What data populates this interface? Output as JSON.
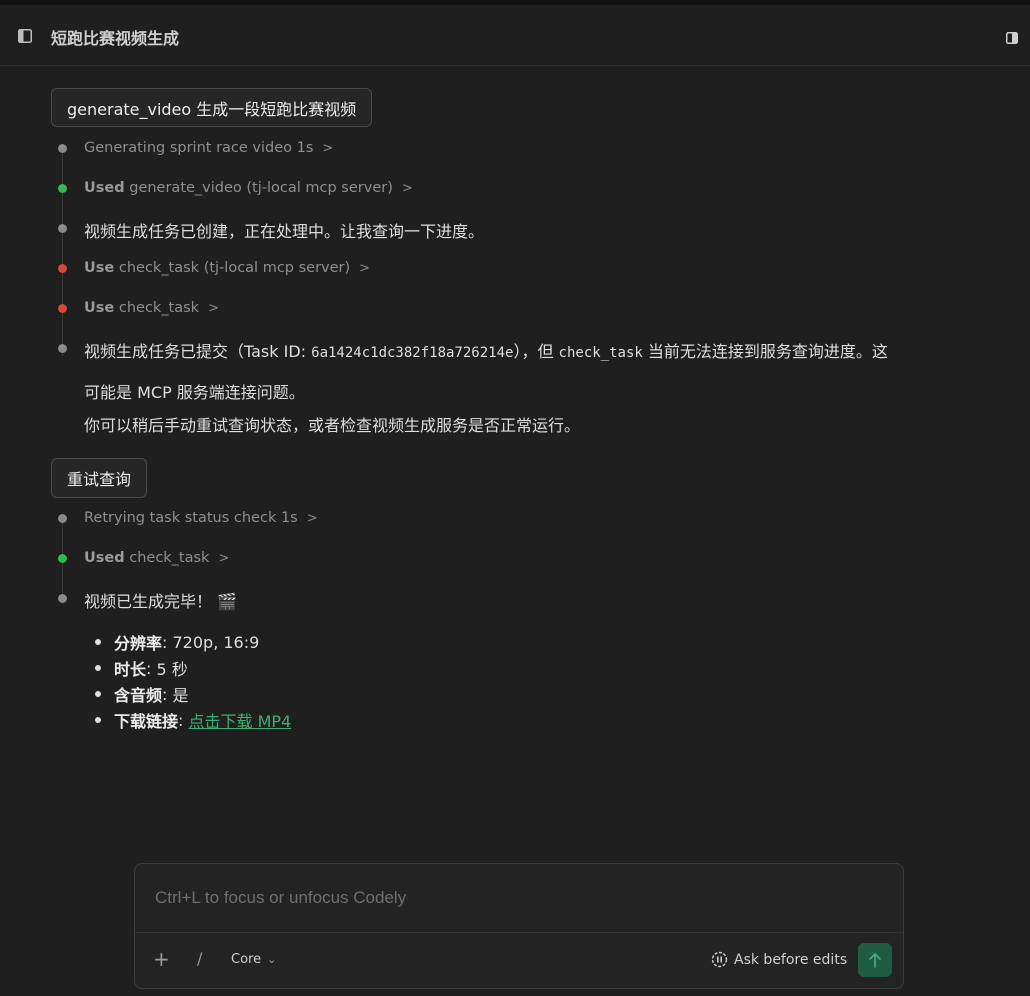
{
  "header": {
    "title": "短跑比赛视频生成"
  },
  "thread": {
    "prompt1": "generate_video 生成一段短跑比赛视频",
    "steps1": [
      {
        "label": "",
        "text": "Generating sprint race video 1s"
      },
      {
        "label": "Used",
        "text": "generate_video (tj-local mcp server)"
      }
    ],
    "msg1": "视频生成任务已创建，正在处理中。让我查询一下进度。",
    "steps2": [
      {
        "label": "Use",
        "text": "check_task (tj-local mcp server)"
      },
      {
        "label": "Use",
        "text": "check_task"
      }
    ],
    "msg2": {
      "part1": "视频生成任务已提交（Task ID: ",
      "task_id": "6a1424c1dc382f18a726214e",
      "part2": "），但 ",
      "code": "check_task",
      "part3": " 当前无法连接到服务查询进度。这",
      "line2": "可能是 MCP 服务端连接问题。",
      "line3": "你可以稍后手动重试查询状态，或者检查视频生成服务是否正常运行。"
    },
    "prompt2": "重试查询",
    "steps3": [
      {
        "label": "",
        "text": "Retrying task status check 1s"
      },
      {
        "label": "Used",
        "text": "check_task"
      }
    ],
    "msg3": "视频已生成完毕！",
    "msg3_emoji": "🎬",
    "details": [
      {
        "key": "分辨率",
        "value": "720p, 16:9"
      },
      {
        "key": "时长",
        "value": "5 秒"
      },
      {
        "key": "含音频",
        "value": "是"
      },
      {
        "key": "下载链接",
        "link": "点击下载 MP4"
      }
    ]
  },
  "composer": {
    "placeholder": "Ctrl+L to focus or unfocus Codely",
    "plus": "+",
    "slash": "/",
    "model": "Core",
    "mode": "Ask before edits"
  },
  "colors": {
    "accent_green": "#35b84f",
    "error_red": "#d9463a",
    "link": "#3fae74",
    "send": "#1e5d44"
  }
}
